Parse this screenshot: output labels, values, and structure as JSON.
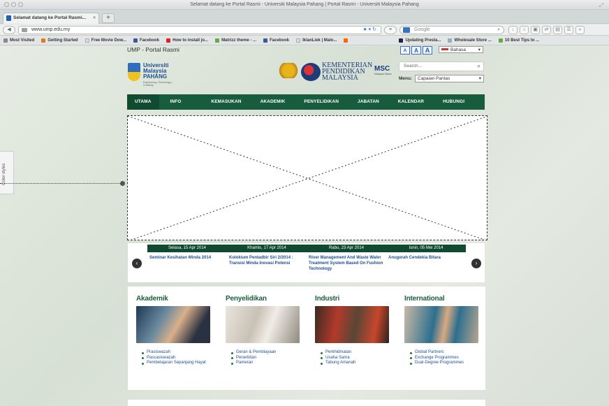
{
  "browser": {
    "window_title": "Selamat datang ke Portal Rasmi - Universiti Malaysia Pahang | Portal Rasmi - Universiti Malaysia Pahang",
    "tab_label": "Selamat datang ke Portal Rasmi...",
    "new_tab": "+",
    "url": "www.ump.edu.my",
    "search_engine": "Google",
    "bookmarks": [
      "Most Visited",
      "Getting Started",
      "Free Movie Dow...",
      "Facebook",
      "How to install jo...",
      "Matrizz theme - ...",
      "Facebook",
      "IklanLiek | Malo...",
      "",
      "Updating Presta...",
      "Wholesale Store ...",
      "10 Best Tips to ..."
    ]
  },
  "side_tab": {
    "label": "Color styles"
  },
  "header": {
    "portal_label": "UMP - Portal Rasmi",
    "font_sizes": [
      "A",
      "A",
      "A"
    ],
    "language": "Bahasa",
    "logo_text": [
      "Universiti",
      "Malaysia",
      "PAHANG"
    ],
    "logo_tagline": "Engineering • Technology • Creativity",
    "kementerian": [
      "KEMENTERIAN",
      "PENDIDIKAN",
      "MALAYSIA"
    ],
    "msc_label": "MSC",
    "msc_sub": "Malaysia Status",
    "search_placeholder": "Search...",
    "menu_label": "Menu:",
    "menu_value": "Capaian Pantas"
  },
  "nav": {
    "items": [
      "UTAMA",
      "INFO UMP",
      "KEMASUKAN",
      "AKADEMIK",
      "PENYELIDIKAN",
      "JABATAN",
      "KALENDAR",
      "HUBUNGI KAMI"
    ]
  },
  "events": [
    {
      "date": "Selasa, 15 Apr 2014",
      "title": "Seminar Kesihatan Minda 2014"
    },
    {
      "date": "Khamis, 17 Apr 2014",
      "title": "Kolokium Pentadbir Siri 2/2014 : Transisi Minda Inovasi Potensi"
    },
    {
      "date": "Rabu, 23 Apr 2014",
      "title": "River Management And Waste Water Treatment System Based On Fushion Technology"
    },
    {
      "date": "Isnin, 05 Mei 2014",
      "title": "Anugerah Cendekia Bitara"
    }
  ],
  "categories": [
    {
      "title": "Akademik",
      "links": [
        "Prasiswazah",
        "Pascasiswazah",
        "Pembelajaran Sepanjang Hayat"
      ]
    },
    {
      "title": "Penyelidikan",
      "links": [
        "Geran & Pembiayaan",
        "Penerbitan",
        "Pameran"
      ]
    },
    {
      "title": "Industri",
      "links": [
        "Perkhidmatan",
        "Usaha Sama",
        "Tabung Amanah"
      ]
    },
    {
      "title": "International",
      "links": [
        "Global Partners",
        "Exchange Programmes",
        "Dual-Degree Programmes"
      ]
    }
  ],
  "colors": {
    "nav_green": "#185c3e",
    "heading_green": "#1a5f3a",
    "link_blue": "#1f4e8f"
  }
}
